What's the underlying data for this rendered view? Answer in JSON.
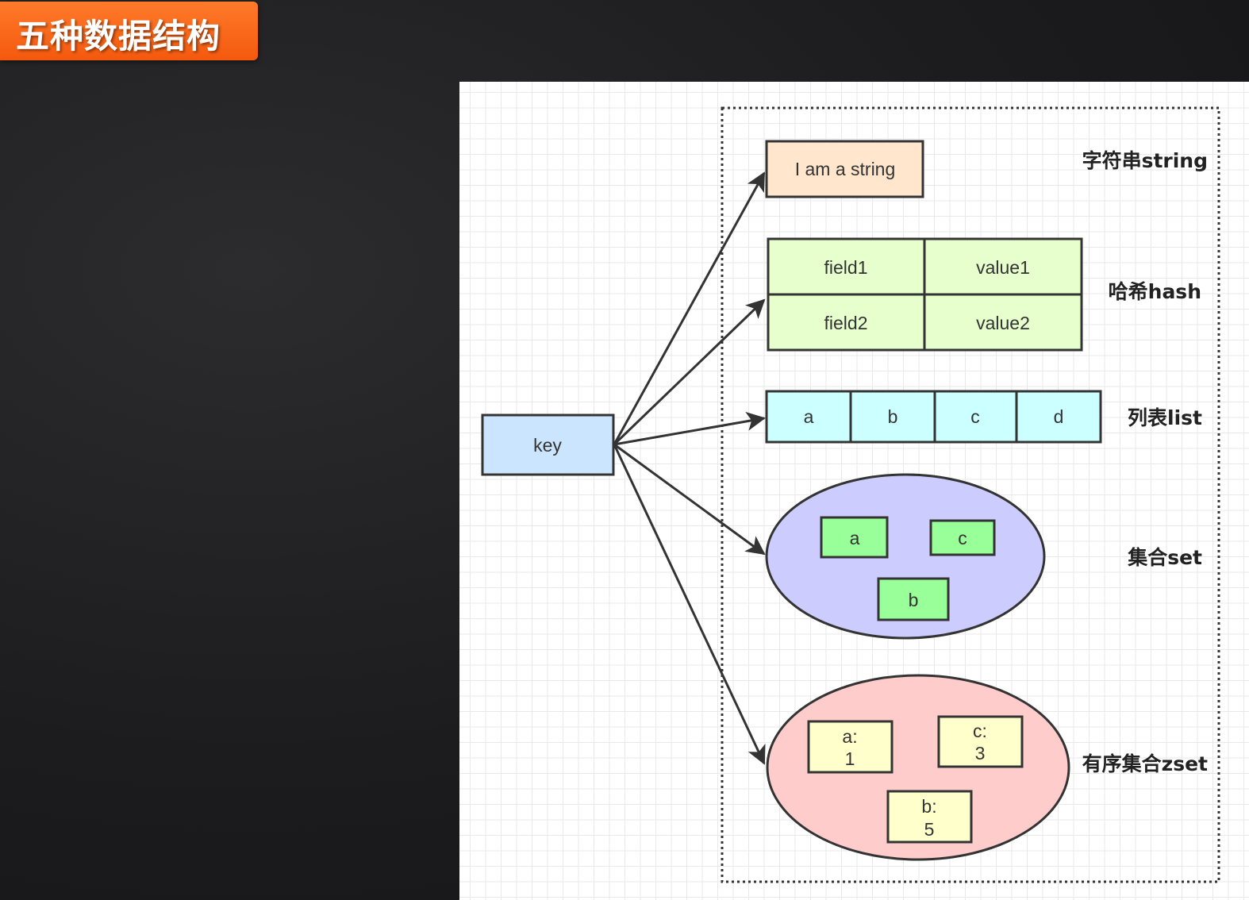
{
  "title": "五种数据结构",
  "diagram": {
    "key_label": "key",
    "string": {
      "type_label": "字符串string",
      "value": "I am a string"
    },
    "hash": {
      "type_label": "哈希hash",
      "rows": [
        {
          "field": "field1",
          "value": "value1"
        },
        {
          "field": "field2",
          "value": "value2"
        }
      ]
    },
    "list": {
      "type_label": "列表list",
      "items": [
        "a",
        "b",
        "c",
        "d"
      ]
    },
    "set": {
      "type_label": "集合set",
      "items": [
        "a",
        "c",
        "b"
      ]
    },
    "zset": {
      "type_label": "有序集合zset",
      "items": [
        {
          "member": "a:",
          "score": "1"
        },
        {
          "member": "c:",
          "score": "3"
        },
        {
          "member": "b:",
          "score": "5"
        }
      ]
    }
  },
  "colors": {
    "key_fill": "#cce5ff",
    "string_fill": "#ffe6cc",
    "hash_fill": "#e6ffcc",
    "list_fill": "#ccffff",
    "set_fill": "#ccccff",
    "set_item_fill": "#99ff99",
    "zset_fill": "#ffcccc",
    "zset_item_fill": "#ffffcc",
    "title_badge": "#f4590e"
  }
}
